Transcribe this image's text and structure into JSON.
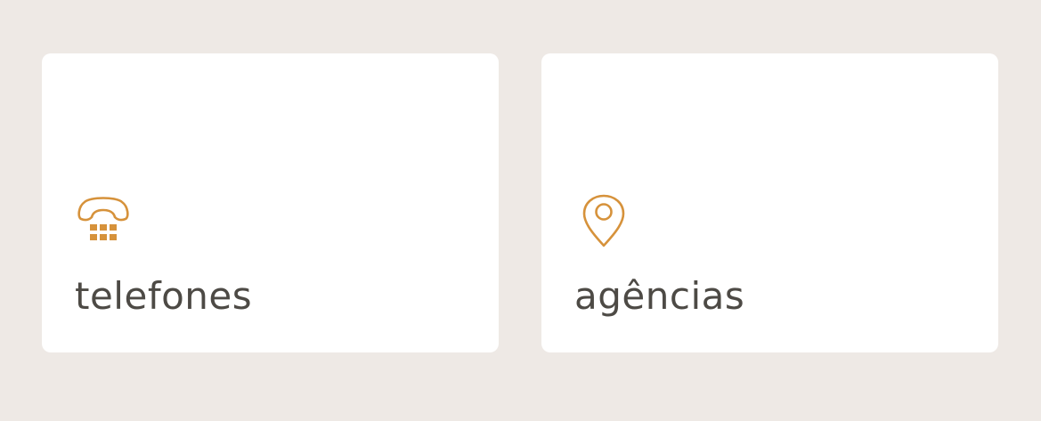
{
  "cards": [
    {
      "label": "telefones",
      "icon": "phone-keypad-icon"
    },
    {
      "label": "agências",
      "icon": "map-pin-icon"
    }
  ],
  "colors": {
    "background": "#eee9e5",
    "card": "#ffffff",
    "accent": "#d6923b",
    "text": "#4d4a45"
  }
}
